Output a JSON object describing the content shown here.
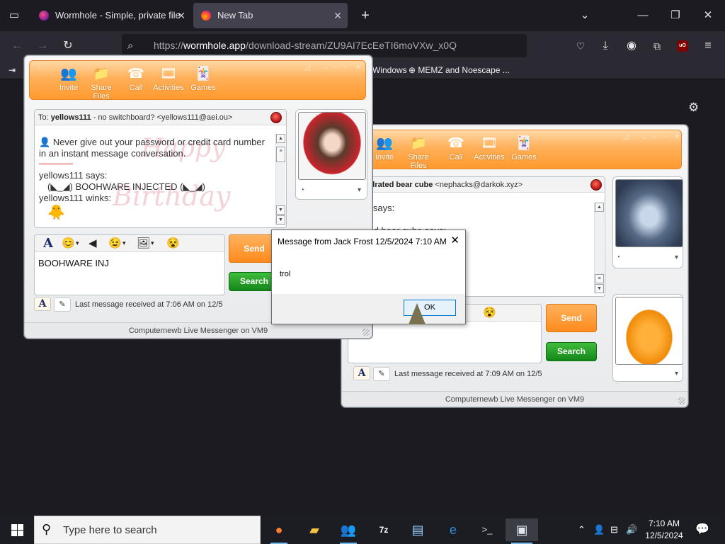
{
  "browser": {
    "tabs": [
      {
        "label": "Wormhole - Simple, private file",
        "active": false
      },
      {
        "label": "New Tab",
        "active": true
      }
    ],
    "url_prefix": "https://",
    "url_host": "wormhole.app",
    "url_path": "/download-stream/ZU9AI7EcEeTI6moVXw_x0Q",
    "bookmarks": [
      {
        "label": "Windows"
      },
      {
        "label": "MEMZ and Noescape ..."
      }
    ],
    "ublock_badge": "uO",
    "icons": {
      "tab_list": "tab-list-icon",
      "new_tab": "plus-icon",
      "back": "back-arrow-icon",
      "forward": "forward-arrow-icon",
      "reload": "reload-icon",
      "pocket": "pocket-icon",
      "downloads": "download-icon",
      "account": "account-icon",
      "extensions": "extensions-icon",
      "menu": "hamburger-menu-icon"
    }
  },
  "toolbar": {
    "buttons": [
      {
        "label": "Invite",
        "icon": "invite-icon"
      },
      {
        "label": "Share Files",
        "icon": "folder-icon"
      },
      {
        "label": "Call",
        "icon": "phone-icon"
      },
      {
        "label": "Activities",
        "icon": "film-reel-icon"
      },
      {
        "label": "Games",
        "icon": "cards-icon"
      }
    ]
  },
  "chat_a": {
    "to_label": "To:",
    "to_name": "yellows111",
    "to_note": "- no switchboard? <yellows111@aei.ou>",
    "security_notice": "Never give out your password or credit card number in an instant message conversation.",
    "line1_author": "yellows111 says:",
    "line1_text": "(◣_◢) BOOHWARE INJECTED (◣_◢)",
    "line2_author": "yellows111 winks:",
    "draft": "BOOHWARE INJ",
    "send": "Send",
    "search": "Search",
    "last_message": "Last message received at 7:06 AM on 12/5",
    "status": "Computernewb Live Messenger on VM9"
  },
  "chat_b": {
    "to_name": "dehydrated bear cube",
    "to_email": "<nephacks@darkok.xyz>",
    "line1_author": "0b0t says:",
    "partial_1": "drated bear cube says:",
    "partial_2": "s:",
    "partial_3": "s:",
    "send": "Send",
    "search": "Search",
    "last_message": "Last message received at 7:09 AM on 12/5",
    "status": "Computernewb Live Messenger on VM9"
  },
  "dialog": {
    "title": "Message from Jack Frost 12/5/2024 7:10 AM",
    "body": "trol",
    "ok": "OK"
  },
  "taskbar": {
    "search_placeholder": "Type here to search",
    "time": "7:10 AM",
    "date": "12/5/2024",
    "apps": [
      {
        "name": "firefox-icon"
      },
      {
        "name": "file-explorer-icon"
      },
      {
        "name": "messenger-icon"
      },
      {
        "name": "7zip-icon"
      },
      {
        "name": "notepad-icon"
      },
      {
        "name": "internet-explorer-icon"
      },
      {
        "name": "command-prompt-icon"
      },
      {
        "name": "window-app-icon"
      }
    ]
  },
  "colors": {
    "browser_bg": "#1c1b22",
    "toolbar_orange": "#ff9a2e",
    "send_orange": "#ff8a1c",
    "search_green": "#14861a",
    "taskbar_bg": "#1b1d22"
  }
}
